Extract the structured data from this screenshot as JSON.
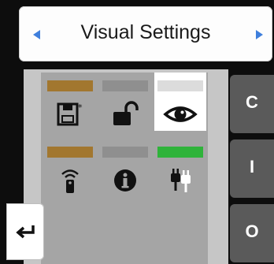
{
  "header": {
    "title": "Visual Settings"
  },
  "grid": [
    {
      "name": "save-settings",
      "icon": "save-star-icon",
      "stripe_color": "#a2772f",
      "selected": false
    },
    {
      "name": "lock",
      "icon": "unlock-icon",
      "stripe_color": "#8f8f8f",
      "selected": false
    },
    {
      "name": "visual",
      "icon": "eye-icon",
      "stripe_color": "#dcdcdc",
      "selected": true
    },
    {
      "name": "remote",
      "icon": "remote-wireless-icon",
      "stripe_color": "#a2772f",
      "selected": false
    },
    {
      "name": "info",
      "icon": "info-icon",
      "stripe_color": "#8f8f8f",
      "selected": false
    },
    {
      "name": "power",
      "icon": "plugs-icon",
      "stripe_color": "#2fb33a",
      "selected": false
    }
  ],
  "side_buttons": [
    {
      "label": "C"
    },
    {
      "label": "I"
    },
    {
      "label": "O"
    }
  ],
  "colors": {
    "accent": "#3f7fdc",
    "side_button_bg": "#5a5a5a",
    "panel_bg": "#c6c6c6",
    "grid_bg": "#a5a5a5"
  }
}
